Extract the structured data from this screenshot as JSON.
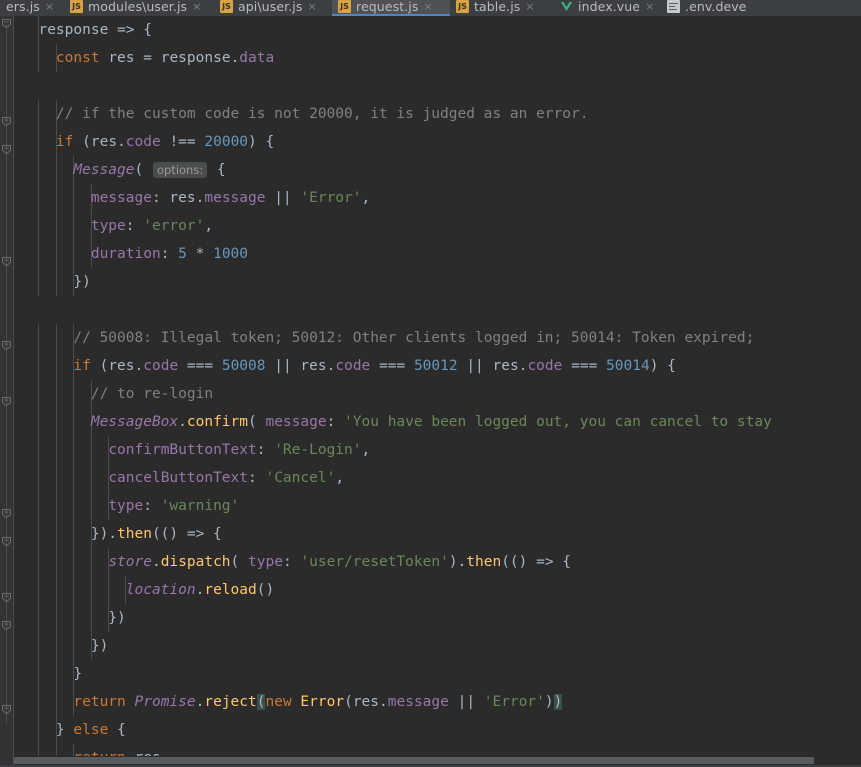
{
  "window": {
    "background": "#2b2b2b",
    "tabbar_background": "#3c3f41",
    "active_tab_background": "#4e5254",
    "accent": "#4a88c7"
  },
  "tabbar": {
    "tabs": [
      {
        "label": "ers.js",
        "icon": "js-file-icon",
        "active": false,
        "close": "×",
        "truncated_left": true
      },
      {
        "label": "modules\\user.js",
        "icon": "js-file-icon",
        "active": false,
        "close": "×"
      },
      {
        "label": "api\\user.js",
        "icon": "js-file-icon",
        "active": false,
        "close": "×"
      },
      {
        "label": "request.js",
        "icon": "js-file-icon",
        "active": true,
        "close": "×"
      },
      {
        "label": "table.js",
        "icon": "js-file-icon",
        "active": false,
        "close": "×"
      },
      {
        "label": "index.vue",
        "icon": "vue-file-icon",
        "active": false,
        "close": "×"
      },
      {
        "label": ".env.deve",
        "icon": "env-file-icon",
        "active": false,
        "close": ""
      }
    ]
  },
  "editor": {
    "file": "request.js",
    "language": "javascript",
    "inlay_hints": [
      {
        "line": 5,
        "text": "options:"
      },
      {
        "line": 17,
        "text": "message:"
      },
      {
        "line": 22,
        "text": "type:"
      }
    ],
    "code_lines": [
      "  response => {",
      "    const res = response.data",
      "",
      "    // if the custom code is not 20000, it is judged as an error.",
      "    if (res.code !== 20000) {",
      "      Message( options: {",
      "        message: res.message || 'Error',",
      "        type: 'error',",
      "        duration: 5 * 1000",
      "      })",
      "",
      "      // 50008: Illegal token; 50012: Other clients logged in; 50014: Token expired;",
      "      if (res.code === 50008 || res.code === 50012 || res.code === 50014) {",
      "        // to re-login",
      "        MessageBox.confirm( message: 'You have been logged out, you can cancel to stay",
      "          confirmButtonText: 'Re-Login',",
      "          cancelButtonText: 'Cancel',",
      "          type: 'warning'",
      "        }).then(() => {",
      "          store.dispatch( type: 'user/resetToken').then(() => {",
      "            location.reload()",
      "          })",
      "        })",
      "      }",
      "      return Promise.reject(new Error(res.message || 'Error'))",
      "    } else {",
      "      return res"
    ],
    "syntax_colors": {
      "keyword": "#cc7832",
      "number": "#6897bb",
      "string": "#6a8759",
      "comment": "#808080",
      "property": "#9876aa",
      "identifier": "#a9b7c6",
      "function": "#ffc66d",
      "static_field": "#9876aa",
      "inlay_hint_bg": "#4a4d4e",
      "matching_bracket_bg": "#3b514d"
    }
  },
  "gutter": {
    "markers": [
      "code-fold-marker",
      "code-fold-marker",
      "code-fold-marker",
      "code-fold-marker",
      "code-fold-marker",
      "code-fold-marker",
      "code-fold-marker",
      "code-fold-marker",
      "code-fold-marker",
      "code-fold-marker",
      "code-fold-marker"
    ]
  },
  "scrollbar": {
    "orientation": "horizontal",
    "thumb_color": "#595b5d"
  }
}
